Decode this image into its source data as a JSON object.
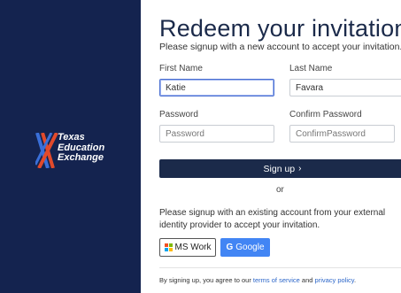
{
  "brand": {
    "line1": "Texas",
    "line2": "Education",
    "line3": "Exchange",
    "colors": {
      "panel": "#14234f",
      "stripe_orange": "#e24a2b",
      "stripe_blue": "#3a6fd8"
    }
  },
  "page": {
    "title": "Redeem your invitation",
    "subtitle": "Please signup with a new account to accept your invitation."
  },
  "form": {
    "first_name_label": "First Name",
    "first_name_value": "Katie",
    "last_name_label": "Last Name",
    "last_name_value": "Favara",
    "password_label": "Password",
    "password_placeholder": "Password",
    "confirm_label": "Confirm Password",
    "confirm_placeholder": "ConfirmPassword",
    "signup_label": "Sign up",
    "signup_chevron": "›"
  },
  "divider_text": "or",
  "external": {
    "text": "Please signup with an existing account from your external identity provider to accept your invitation.",
    "ms_label": "MS Work",
    "google_label": "Google",
    "google_glyph": "G"
  },
  "footer": {
    "prefix": "By signing up, you agree to our ",
    "terms": "terms of service",
    "and": " and ",
    "privacy": "privacy policy",
    "suffix": "."
  }
}
